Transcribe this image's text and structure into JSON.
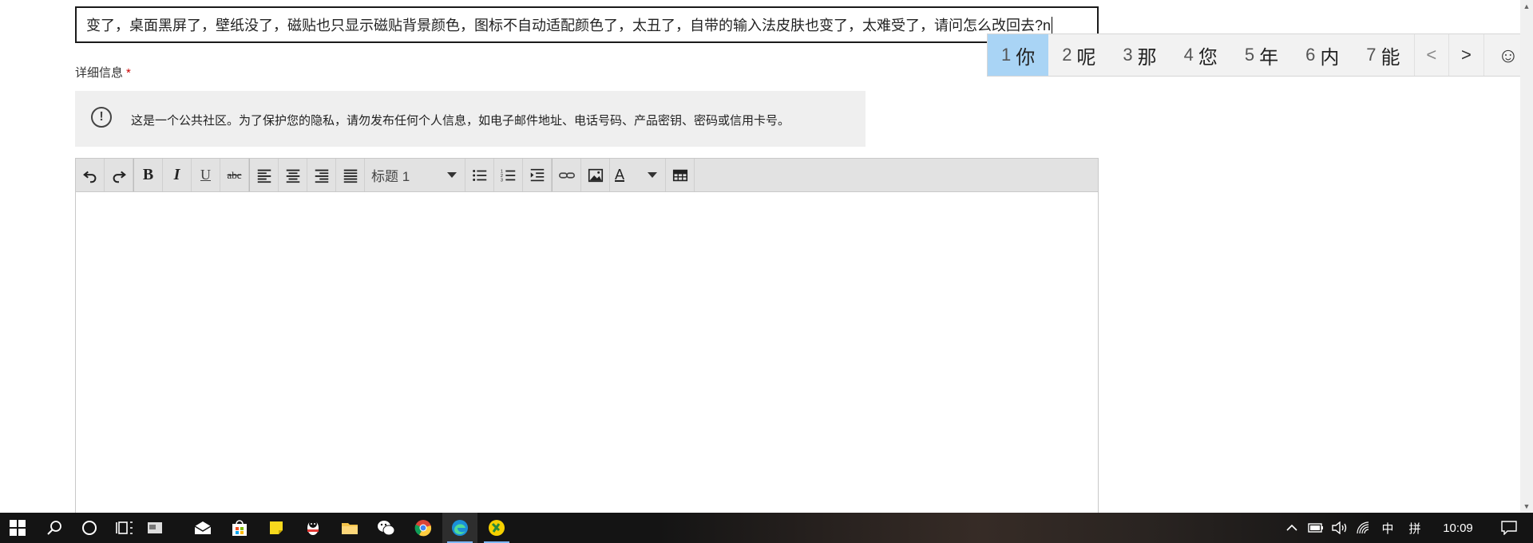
{
  "subject": {
    "value": "变了，桌面黑屏了，壁纸没了，磁贴也只显示磁贴背景颜色，图标不自动适配颜色了，太丑了，自带的输入法皮肤也变了，太难受了，请问怎么改回去?n"
  },
  "details": {
    "label": "详细信息",
    "required_mark": "*"
  },
  "notice": {
    "text": "这是一个公共社区。为了保护您的隐私，请勿发布任何个人信息，如电子邮件地址、电话号码、产品密钥、密码或信用卡号。"
  },
  "toolbar": {
    "heading_select": "标题 1",
    "font_color_letter": "A"
  },
  "ime": {
    "candidates": [
      {
        "num": "1",
        "char": "你"
      },
      {
        "num": "2",
        "char": "呢"
      },
      {
        "num": "3",
        "char": "那"
      },
      {
        "num": "4",
        "char": "您"
      },
      {
        "num": "5",
        "char": "年"
      },
      {
        "num": "6",
        "char": "内"
      },
      {
        "num": "7",
        "char": "能"
      }
    ],
    "prev": "<",
    "next": ">",
    "emoji": "☺"
  },
  "tray": {
    "ime_mode": "中",
    "ime_layout": "拼",
    "time": "10:09"
  },
  "colors": {
    "ime_selected": "#a9d4f5",
    "taskbar_bg": "#141414",
    "required": "#cc0000"
  }
}
